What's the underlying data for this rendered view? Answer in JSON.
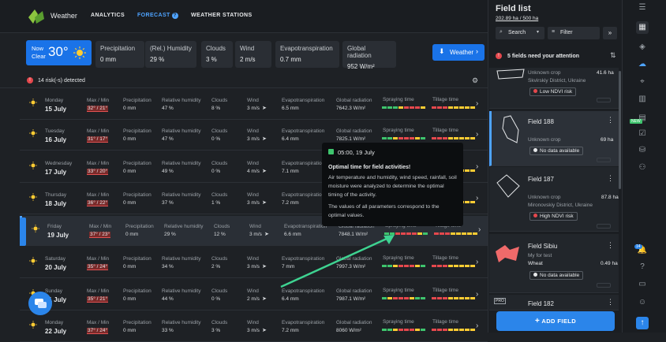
{
  "app": {
    "name": "Weather"
  },
  "nav": {
    "analytics": "ANALYTICS",
    "forecast": "FORECAST",
    "weather_stations": "WEATHER STATIONS"
  },
  "now": {
    "label": "Now",
    "condition": "Clear",
    "temp": "30°"
  },
  "current": [
    {
      "label": "Precipitation",
      "value": "0 mm"
    },
    {
      "label": "(Rel.) Humidity",
      "value": "29 %"
    },
    {
      "label": "Clouds",
      "value": "3 %"
    },
    {
      "label": "Wind",
      "value": "2 m/s"
    },
    {
      "label": "Evapotranspiration",
      "value": "0.7 mm"
    },
    {
      "label": "Global radiation",
      "value": "952 W/m²"
    }
  ],
  "weather_button": "Weather",
  "risks": "14 risk(-s) detected",
  "col_labels": {
    "maxmin": "Max / Min",
    "precip": "Precipitation",
    "hum": "Relative humidity",
    "clouds": "Clouds",
    "wind": "Wind",
    "evap": "Evapotranspiration",
    "rad": "Global radiation",
    "spray": "Spraying time",
    "till": "Tillage time"
  },
  "rows": [
    {
      "day": "Monday",
      "date": "15 July",
      "temp": "32° / 21°",
      "precip": "0 mm",
      "hum": "47 %",
      "clouds": "8 %",
      "wind": "3 m/s",
      "evap": "6.5 mm",
      "rad": "7642.3 W/m²"
    },
    {
      "day": "Tuesday",
      "date": "16 July",
      "temp": "31° / 17°",
      "precip": "0 mm",
      "hum": "47 %",
      "clouds": "0 %",
      "wind": "3 m/s",
      "evap": "6.4 mm",
      "rad": "7825.1 W/m²"
    },
    {
      "day": "Wednesday",
      "date": "17 July",
      "temp": "33° / 20°",
      "precip": "0 mm",
      "hum": "49 %",
      "clouds": "0 %",
      "wind": "4 m/s",
      "evap": "7.1 mm",
      "rad": ""
    },
    {
      "day": "Thursday",
      "date": "18 July",
      "temp": "36° / 22°",
      "precip": "0 mm",
      "hum": "37 %",
      "clouds": "1 %",
      "wind": "3 m/s",
      "evap": "7.2 mm",
      "rad": ""
    },
    {
      "day": "Friday",
      "date": "19 July",
      "temp": "37° / 23°",
      "precip": "0 mm",
      "hum": "29 %",
      "clouds": "12 %",
      "wind": "3 m/s",
      "evap": "6.6 mm",
      "rad": "7848.1 W/m²"
    },
    {
      "day": "Saturday",
      "date": "20 July",
      "temp": "35° / 24°",
      "precip": "0 mm",
      "hum": "34 %",
      "clouds": "2 %",
      "wind": "3 m/s",
      "evap": "7 mm",
      "rad": "7997.3 W/m²"
    },
    {
      "day": "Sunday",
      "date": "21 July",
      "temp": "35° / 21°",
      "precip": "0 mm",
      "hum": "44 %",
      "clouds": "0 %",
      "wind": "2 m/s",
      "evap": "6.4 mm",
      "rad": "7987.1 W/m²"
    },
    {
      "day": "Monday",
      "date": "22 July",
      "temp": "37° / 24°",
      "precip": "0 mm",
      "hum": "33 %",
      "clouds": "3 %",
      "wind": "3 m/s",
      "evap": "7.2 mm",
      "rad": "8060 W/m²"
    }
  ],
  "tooltip": {
    "time": "05:00,  19 July",
    "title": "Optimal time for field activities!",
    "p1": "Air temperature and humidity, wind speed, rainfall, soil moisture were analyzed to determine the optimal timing of the activity.",
    "p2": "The values of all parameters correspond to the optimal values."
  },
  "fieldlist": {
    "title": "Field list",
    "area": "202.89 ha / 500 ha",
    "search": "Search",
    "filter": "Filter",
    "attention": "5 fields need your attention"
  },
  "fields": [
    {
      "name": "",
      "crop": "Unknown crop",
      "area": "41.6 ha",
      "loc": "Skvirskiy District, Ukraine",
      "risk": "Low NDVI risk"
    },
    {
      "name": "Field 188",
      "crop": "Unknown crop",
      "area": "69 ha",
      "loc": "",
      "risk": "No data available"
    },
    {
      "name": "Field 187",
      "crop": "Unknown crop",
      "area": "87.8 ha",
      "loc": "Mironovskiy District, Ukraine",
      "risk": "High NDVI risk"
    },
    {
      "name": "Field Sibiu",
      "crop": "My for test",
      "area": "0.49 ha",
      "loc": "Wheat",
      "risk": "No data available"
    },
    {
      "name": "Field 182",
      "crop": "",
      "area": "",
      "loc": "",
      "risk": ""
    }
  ],
  "add_field": "ADD FIELD",
  "notif_count": "14",
  "new_badge": "NEW"
}
